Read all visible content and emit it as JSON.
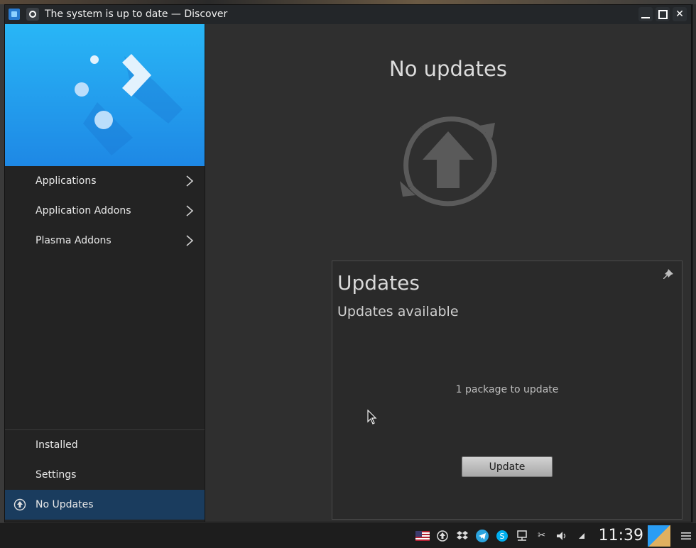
{
  "window": {
    "title": "The system is up to date — Discover"
  },
  "sidebar": {
    "items": [
      {
        "label": "Applications"
      },
      {
        "label": "Application Addons"
      },
      {
        "label": "Plasma Addons"
      }
    ],
    "bottom": [
      {
        "label": "Installed"
      },
      {
        "label": "Settings"
      },
      {
        "label": "No Updates"
      }
    ]
  },
  "main": {
    "title": "No updates",
    "icon": "update-arrow-icon"
  },
  "popup": {
    "title": "Updates",
    "subtitle": "Updates available",
    "count_text": "1 package to update",
    "button_label": "Update"
  },
  "taskbar": {
    "clock": "11:39"
  },
  "colors": {
    "accent": "#1e88e5",
    "active_item": "#1a3c5e"
  }
}
